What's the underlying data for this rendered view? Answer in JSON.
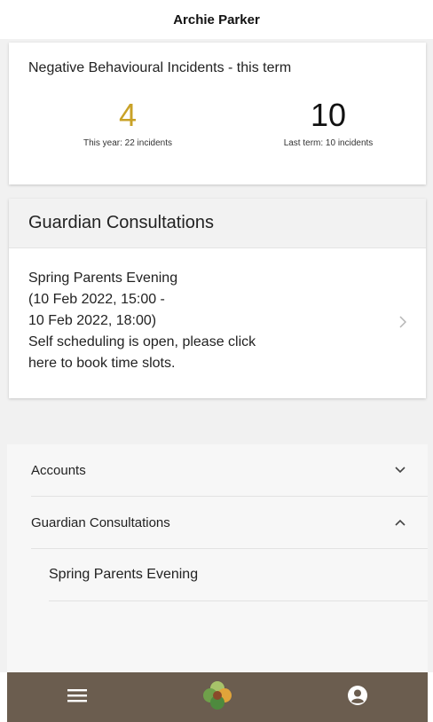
{
  "header": {
    "title": "Archie Parker"
  },
  "incidents": {
    "title": "Negative Behavioural Incidents - this term",
    "current": {
      "value": "4",
      "sub": "This year: 22 incidents"
    },
    "previous": {
      "value": "10",
      "sub": "Last term: 10 incidents"
    }
  },
  "consultations": {
    "heading": "Guardian Consultations",
    "event": {
      "line1": "Spring Parents Evening",
      "line2": "(10 Feb 2022, 15:00 -",
      "line3": "10 Feb 2022, 18:00)",
      "line4": "Self scheduling is open, please click",
      "line5": "here to book time slots."
    }
  },
  "accordion": {
    "items": [
      {
        "label": "Accounts",
        "icon": "chevron-down-icon"
      },
      {
        "label": "Guardian Consultations",
        "icon": "chevron-up-icon"
      }
    ],
    "subitems": [
      {
        "label": "Spring Parents Evening"
      }
    ]
  },
  "tabbar": {
    "icons": [
      "menu-icon",
      "app-logo",
      "profile-icon"
    ],
    "colors": {
      "background": "#6b5d4f",
      "accent": "#c9a227"
    }
  }
}
